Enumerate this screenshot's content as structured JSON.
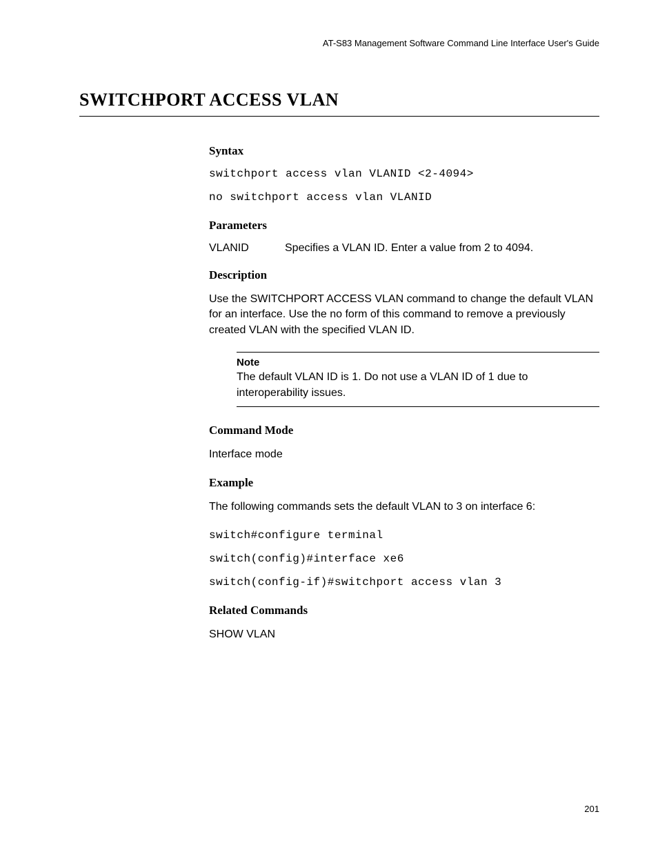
{
  "header": "AT-S83 Management Software Command Line Interface User's Guide",
  "title": "SWITCHPORT ACCESS VLAN",
  "syntax": {
    "heading": "Syntax",
    "line1": "switchport access vlan VLANID <2-4094>",
    "line2": "no switchport access vlan VLANID"
  },
  "parameters": {
    "heading": "Parameters",
    "name": "VLANID",
    "desc": "Specifies a VLAN ID. Enter a value from 2 to 4094."
  },
  "description": {
    "heading": "Description",
    "text": "Use the SWITCHPORT ACCESS VLAN command to change the default VLAN for an interface. Use the no form of this command to remove a previously created VLAN with the specified VLAN ID."
  },
  "note": {
    "label": "Note",
    "text": "The default VLAN ID is 1. Do not use a VLAN ID of 1 due to interoperability issues."
  },
  "command_mode": {
    "heading": "Command Mode",
    "text": "Interface mode"
  },
  "example": {
    "heading": "Example",
    "intro": "The following commands sets the default VLAN to 3 on interface 6:",
    "line1": "switch#configure terminal",
    "line2": "switch(config)#interface xe6",
    "line3": "switch(config-if)#switchport access vlan 3"
  },
  "related": {
    "heading": "Related Commands",
    "text": "SHOW VLAN"
  },
  "page_number": "201"
}
